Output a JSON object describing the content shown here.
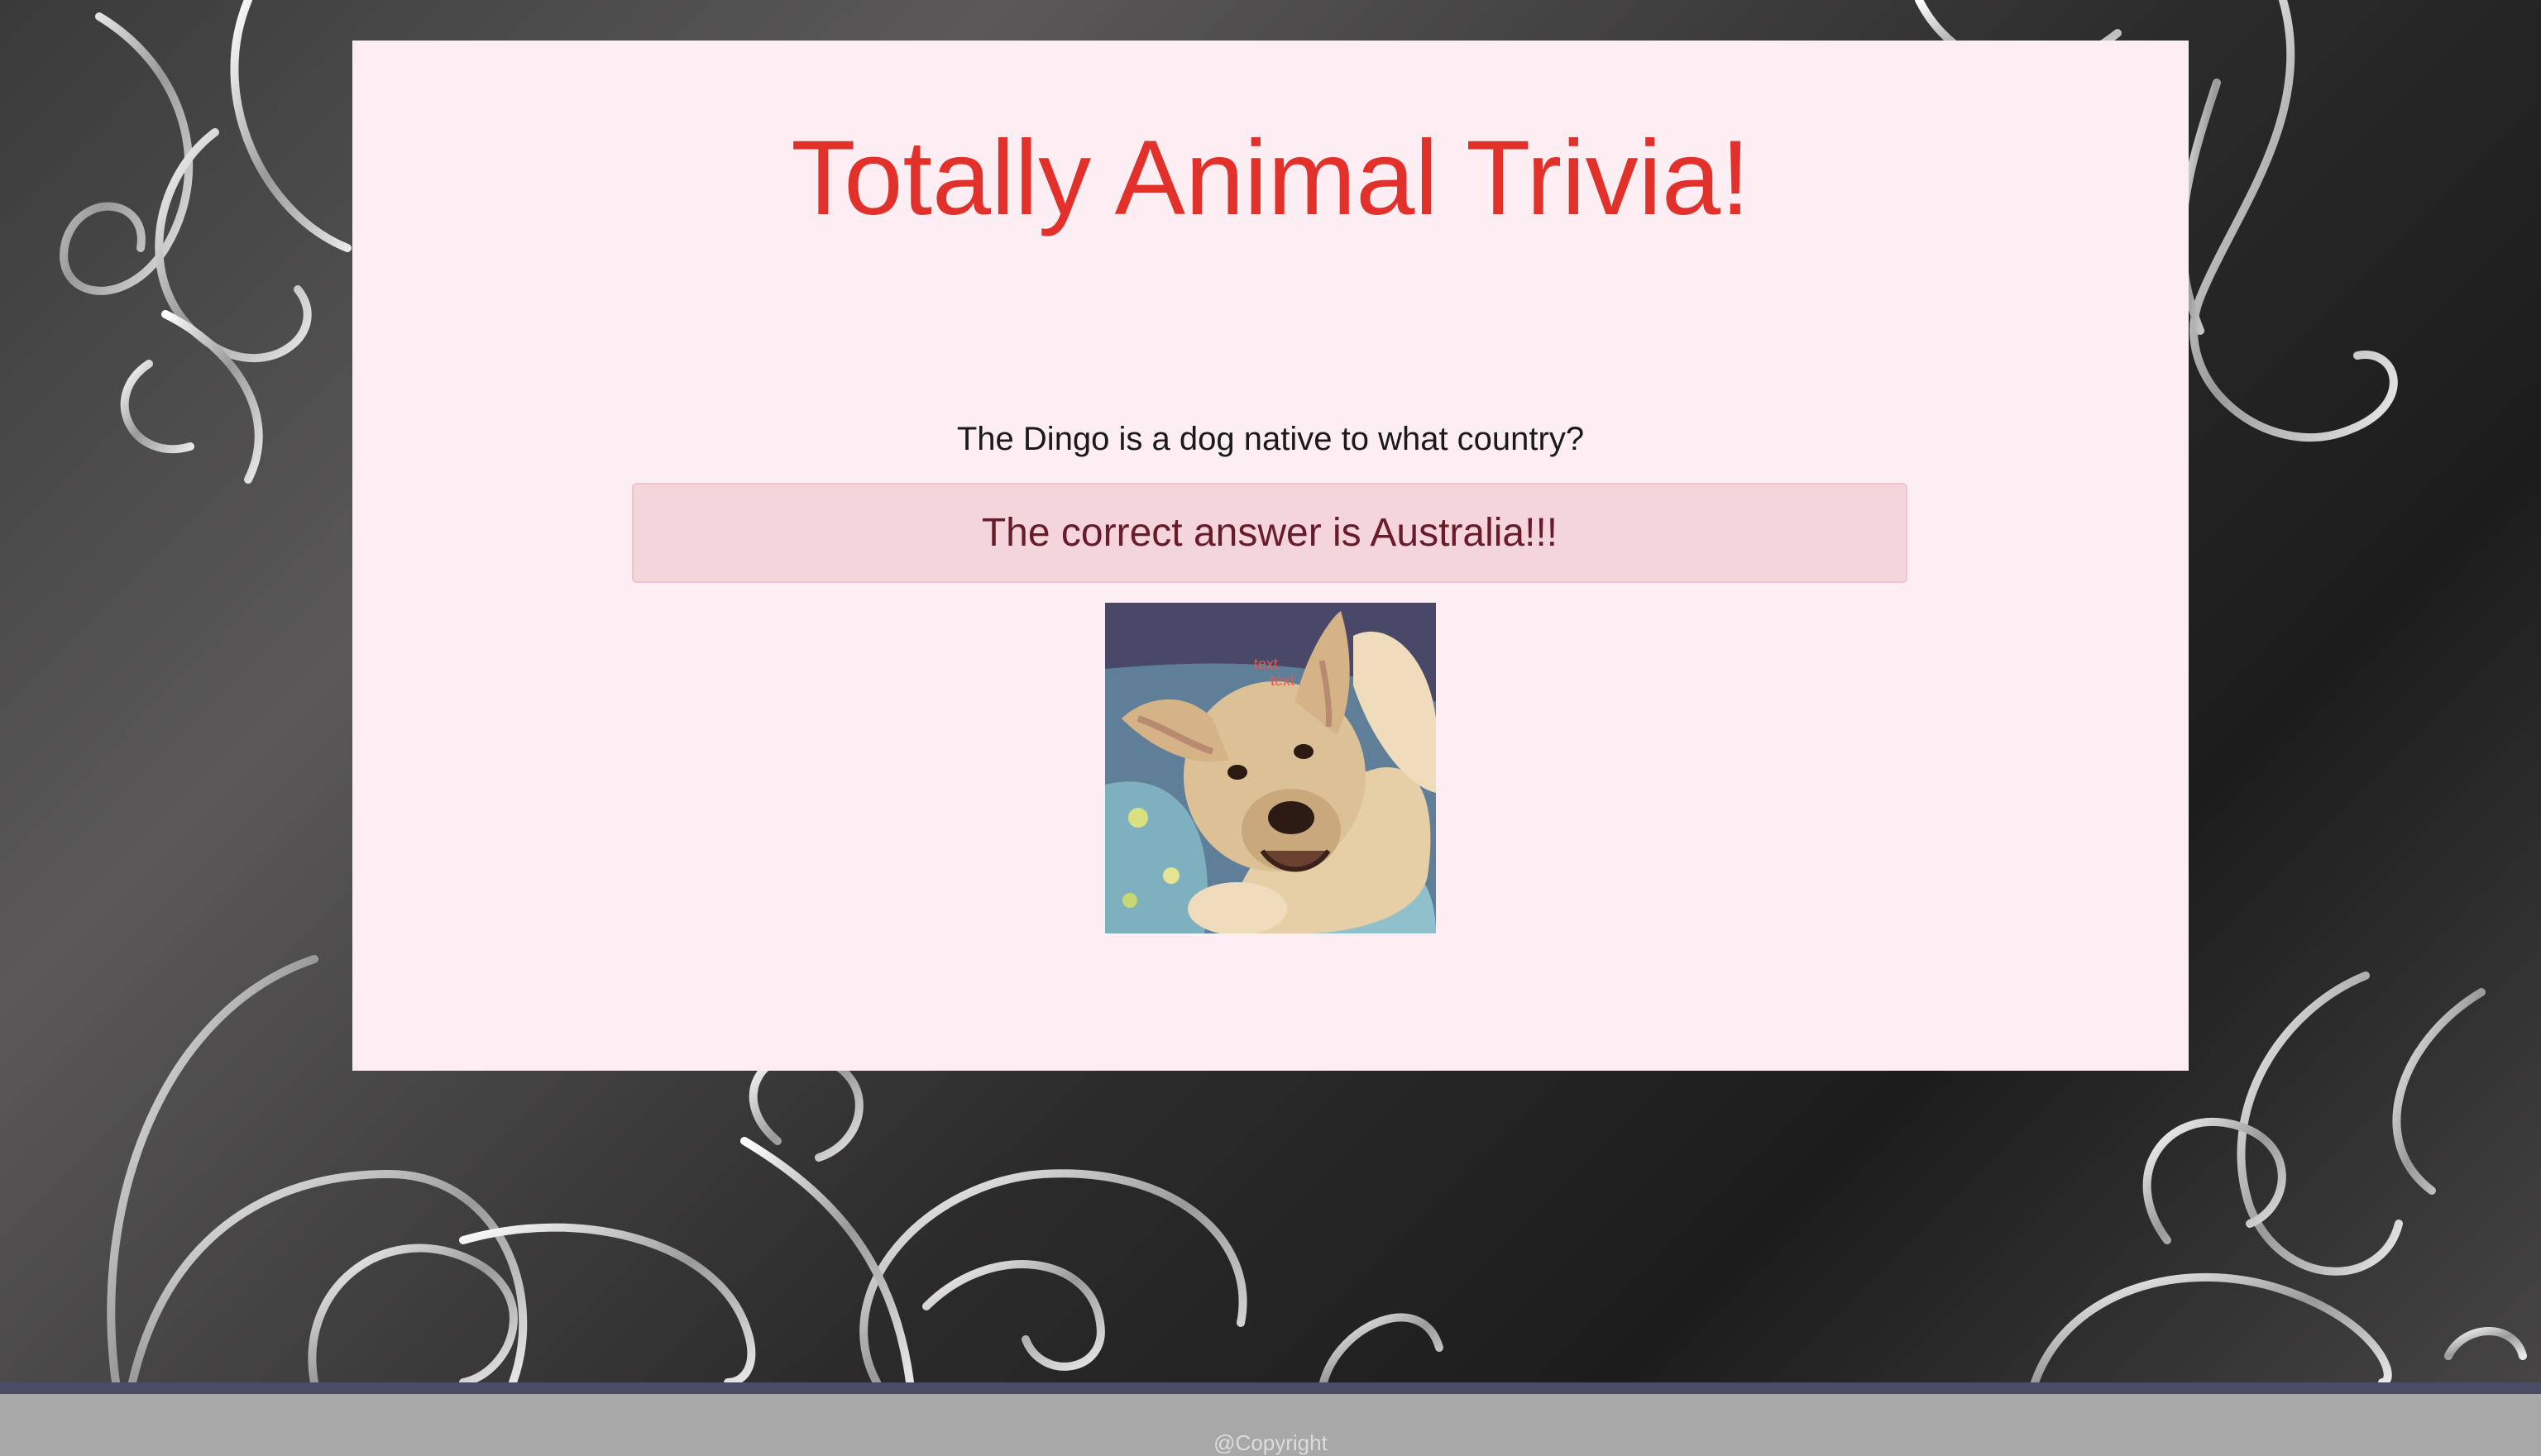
{
  "header": {
    "title": "Totally Animal Trivia!"
  },
  "quiz": {
    "question": "The Dingo is a dog native to what country?",
    "answer_message": "The correct answer is Australia!!!"
  },
  "image": {
    "subject": "dingo-dog-photo",
    "overlay_text": "text"
  },
  "footer": {
    "copyright": "@Copyright"
  },
  "colors": {
    "title": "#e2302a",
    "panel_bg": "#fdeef3",
    "answer_bg": "#f5d5dc",
    "answer_text": "#6a1a28",
    "footer_bg": "#a8a8a8",
    "footer_stripe": "#4a4c66"
  }
}
